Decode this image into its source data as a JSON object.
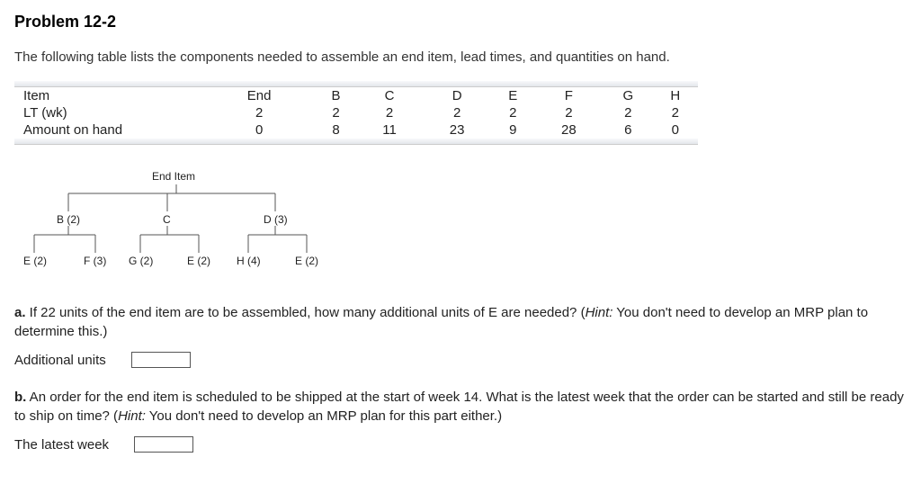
{
  "title": "Problem 12-2",
  "intro": "The following table lists the components needed to assemble an end item, lead times, and quantities on hand.",
  "table": {
    "row_labels": [
      "Item",
      "LT (wk)",
      "Amount on hand"
    ],
    "cols": [
      {
        "item": "End",
        "lt": "2",
        "amt": "0"
      },
      {
        "item": "B",
        "lt": "2",
        "amt": "8"
      },
      {
        "item": "C",
        "lt": "2",
        "amt": "11"
      },
      {
        "item": "D",
        "lt": "2",
        "amt": "23"
      },
      {
        "item": "E",
        "lt": "2",
        "amt": "9"
      },
      {
        "item": "F",
        "lt": "2",
        "amt": "28"
      },
      {
        "item": "G",
        "lt": "2",
        "amt": "6"
      },
      {
        "item": "H",
        "lt": "2",
        "amt": "0"
      }
    ]
  },
  "tree": {
    "end": "End Item",
    "level1": [
      "B (2)",
      "C",
      "D (3)"
    ],
    "level2": [
      "E (2)",
      "F (3)",
      "G (2)",
      "E (2)",
      "H (4)",
      "E (2)"
    ]
  },
  "qa": {
    "a_label": "a.",
    "a_text": " If 22 units of the end item are to be assembled, how many additional units of E are needed? (",
    "a_hint_label": "Hint:",
    "a_hint_text": " You don't need to develop an MRP plan to determine this.)",
    "a_answer_label": "Additional units",
    "b_label": "b.",
    "b_text": " An order for the end item is scheduled to be shipped at the start of week 14. What is the latest week that the order can be started and still be ready to ship on time? (",
    "b_hint_label": "Hint:",
    "b_hint_text": " You don't need to develop an MRP plan for this part either.)",
    "b_answer_label": "The latest week"
  }
}
